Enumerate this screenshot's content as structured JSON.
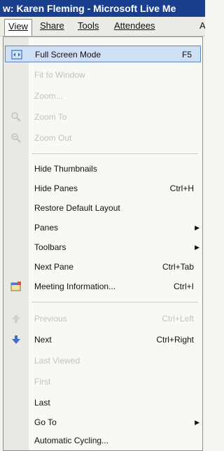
{
  "title": "w: Karen Fleming - Microsoft Live Me",
  "menubar": [
    {
      "label": "View",
      "mnemonic": "V"
    },
    {
      "label": "Share",
      "mnemonic": "S"
    },
    {
      "label": "Tools",
      "mnemonic": "T"
    },
    {
      "label": "Attendees",
      "mnemonic": "A"
    },
    {
      "label": "A"
    }
  ],
  "menu": {
    "full_screen": {
      "label": "Full Screen Mode",
      "shortcut": "F5"
    },
    "fit_window": {
      "label": "Fit to Window"
    },
    "zoom": {
      "label": "Zoom..."
    },
    "zoom_to": {
      "label": "Zoom To"
    },
    "zoom_out": {
      "label": "Zoom Out"
    },
    "hide_thumbnails": {
      "label": "Hide Thumbnails"
    },
    "hide_panes": {
      "label": "Hide Panes",
      "shortcut": "Ctrl+H"
    },
    "restore_layout": {
      "label": "Restore Default Layout"
    },
    "panes": {
      "label": "Panes"
    },
    "toolbars": {
      "label": "Toolbars"
    },
    "next_pane": {
      "label": "Next Pane",
      "shortcut": "Ctrl+Tab"
    },
    "meeting_info": {
      "label": "Meeting Information...",
      "shortcut": "Ctrl+I"
    },
    "previous": {
      "label": "Previous",
      "shortcut": "Ctrl+Left"
    },
    "next": {
      "label": "Next",
      "shortcut": "Ctrl+Right"
    },
    "last_viewed": {
      "label": "Last Viewed"
    },
    "first": {
      "label": "First"
    },
    "last": {
      "label": "Last"
    },
    "go_to": {
      "label": "Go To"
    },
    "automatic_cycling": {
      "label": "Automatic Cycling..."
    }
  },
  "colors": {
    "title_bar": "#1b3f8f",
    "highlight": "#cfe0f6",
    "disabled_text": "#c3c3bd"
  }
}
